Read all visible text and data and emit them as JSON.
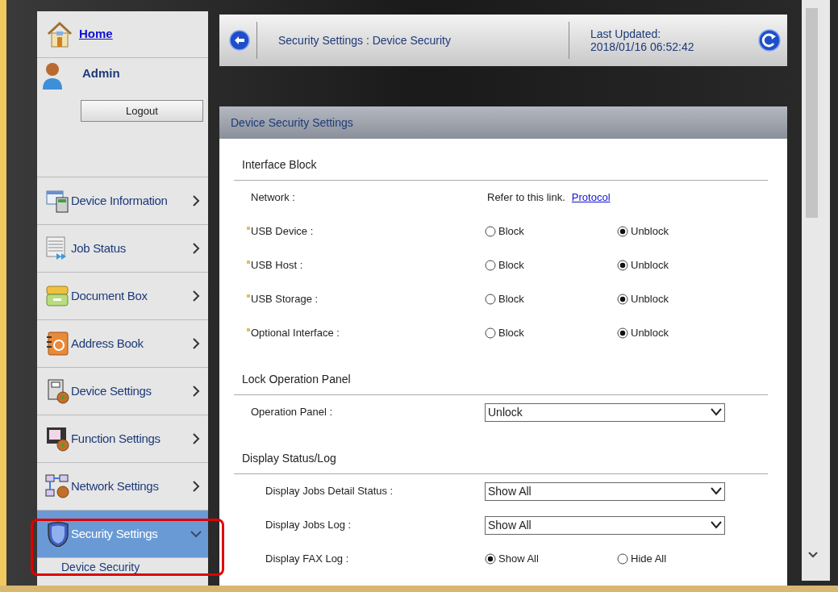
{
  "header": {
    "title": "Security Settings : Device Security",
    "last_updated_label": "Last Updated:",
    "last_updated": "2018/01/16 06:52:42"
  },
  "sidebar": {
    "home": "Home",
    "user": "Admin",
    "logout": "Logout",
    "items": [
      {
        "label": "Device Information",
        "selected": false,
        "expanded": false
      },
      {
        "label": "Job Status",
        "selected": false,
        "expanded": false
      },
      {
        "label": "Document Box",
        "selected": false,
        "expanded": false
      },
      {
        "label": "Address Book",
        "selected": false,
        "expanded": false
      },
      {
        "label": "Device Settings",
        "selected": false,
        "expanded": false
      },
      {
        "label": "Function Settings",
        "selected": false,
        "expanded": false
      },
      {
        "label": "Network Settings",
        "selected": false,
        "expanded": false
      },
      {
        "label": "Security Settings",
        "selected": true,
        "expanded": true
      }
    ],
    "subitems": [
      "Device Security"
    ]
  },
  "panel": {
    "title": "Device Security Settings",
    "sections": [
      {
        "title": "Interface Block",
        "rows": [
          {
            "kind": "link",
            "label": "Network :",
            "required": false,
            "text": "Refer to this link.",
            "link": "Protocol"
          },
          {
            "kind": "radio",
            "label": "USB Device :",
            "required": true,
            "options": [
              {
                "label": "Block",
                "selected": false
              },
              {
                "label": "Unblock",
                "selected": true
              }
            ]
          },
          {
            "kind": "radio",
            "label": "USB Host :",
            "required": true,
            "options": [
              {
                "label": "Block",
                "selected": false
              },
              {
                "label": "Unblock",
                "selected": true
              }
            ]
          },
          {
            "kind": "radio",
            "label": "USB Storage :",
            "required": true,
            "options": [
              {
                "label": "Block",
                "selected": false
              },
              {
                "label": "Unblock",
                "selected": true
              }
            ]
          },
          {
            "kind": "radio",
            "label": "Optional Interface :",
            "required": true,
            "options": [
              {
                "label": "Block",
                "selected": false
              },
              {
                "label": "Unblock",
                "selected": true
              }
            ]
          }
        ]
      },
      {
        "title": "Lock Operation Panel",
        "rows": [
          {
            "kind": "select",
            "label": "Operation Panel :",
            "required": false,
            "value": "Unlock"
          }
        ]
      },
      {
        "title": "Display Status/Log",
        "rows": [
          {
            "kind": "select",
            "label": "Display Jobs Detail Status :",
            "required": false,
            "value": "Show All"
          },
          {
            "kind": "select",
            "label": "Display Jobs Log :",
            "required": false,
            "value": "Show All"
          },
          {
            "kind": "radio",
            "label": "Display FAX Log :",
            "required": false,
            "options": [
              {
                "label": "Show All",
                "selected": true
              },
              {
                "label": "Hide All",
                "selected": false
              }
            ]
          }
        ]
      }
    ]
  }
}
